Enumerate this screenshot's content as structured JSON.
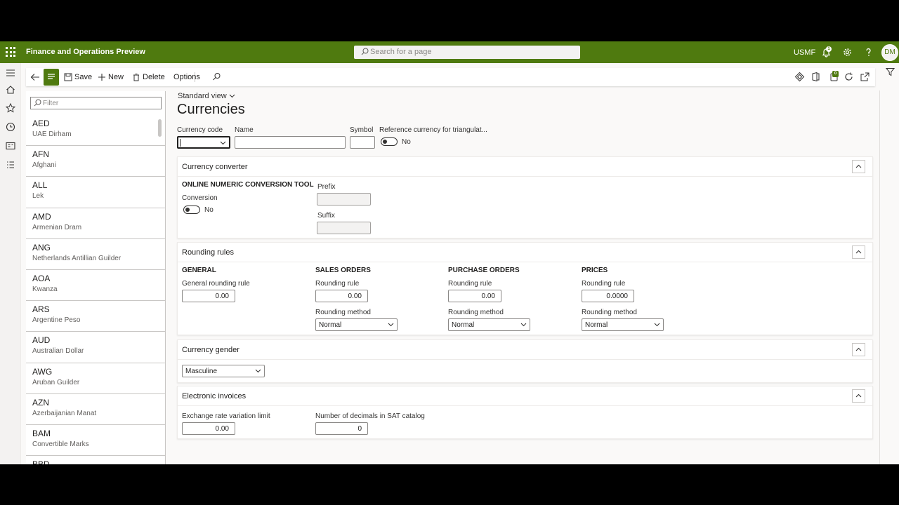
{
  "app": {
    "title": "Finance and Operations Preview",
    "search_placeholder": "Search for a page",
    "company": "USMF",
    "notification_count": "1",
    "user_initials": "DM"
  },
  "actions": {
    "save": "Save",
    "new": "New",
    "delete": "Delete",
    "options": "Options",
    "badge_count": "0"
  },
  "list": {
    "filter_placeholder": "Filter",
    "items": [
      {
        "code": "AED",
        "name": "UAE Dirham"
      },
      {
        "code": "AFN",
        "name": "Afghani"
      },
      {
        "code": "ALL",
        "name": "Lek"
      },
      {
        "code": "AMD",
        "name": "Armenian Dram"
      },
      {
        "code": "ANG",
        "name": "Netherlands Antillian Guilder"
      },
      {
        "code": "AOA",
        "name": "Kwanza"
      },
      {
        "code": "ARS",
        "name": "Argentine Peso"
      },
      {
        "code": "AUD",
        "name": "Australian Dollar"
      },
      {
        "code": "AWG",
        "name": "Aruban Guilder"
      },
      {
        "code": "AZN",
        "name": "Azerbaijanian Manat"
      },
      {
        "code": "BAM",
        "name": "Convertible Marks"
      },
      {
        "code": "BBD",
        "name": ""
      }
    ]
  },
  "form": {
    "view": "Standard view",
    "title": "Currencies",
    "header": {
      "currency_code_label": "Currency code",
      "currency_code_value": "",
      "name_label": "Name",
      "name_value": "",
      "symbol_label": "Symbol",
      "symbol_value": "",
      "reference_label": "Reference currency for triangulat...",
      "reference_value": "No"
    },
    "converter": {
      "title": "Currency converter",
      "group": "ONLINE NUMERIC CONVERSION TOOL",
      "conversion_label": "Conversion",
      "conversion_value": "No",
      "prefix_label": "Prefix",
      "prefix_value": "",
      "suffix_label": "Suffix",
      "suffix_value": ""
    },
    "rounding": {
      "title": "Rounding rules",
      "general": {
        "header": "GENERAL",
        "rule_label": "General rounding rule",
        "rule_value": "0.00"
      },
      "sales": {
        "header": "SALES ORDERS",
        "rule_label": "Rounding rule",
        "rule_value": "0.00",
        "method_label": "Rounding method",
        "method_value": "Normal"
      },
      "purchase": {
        "header": "PURCHASE ORDERS",
        "rule_label": "Rounding rule",
        "rule_value": "0.00",
        "method_label": "Rounding method",
        "method_value": "Normal"
      },
      "prices": {
        "header": "PRICES",
        "rule_label": "Rounding rule",
        "rule_value": "0.0000",
        "method_label": "Rounding method",
        "method_value": "Normal"
      }
    },
    "gender": {
      "title": "Currency gender",
      "value": "Masculine"
    },
    "einvoices": {
      "title": "Electronic invoices",
      "variation_label": "Exchange rate variation limit",
      "variation_value": "0.00",
      "decimals_label": "Number of decimals in SAT catalog",
      "decimals_value": "0"
    }
  },
  "colors": {
    "brand": "#4f7a0f",
    "background": "#faf9f8",
    "border": "#c8c6c4"
  }
}
